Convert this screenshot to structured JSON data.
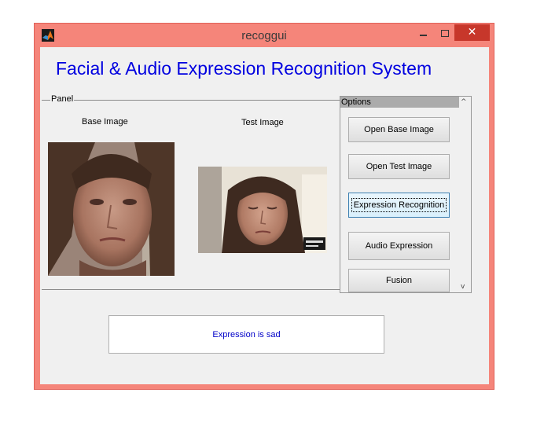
{
  "window": {
    "title": "recoggui",
    "close_glyph": "✕"
  },
  "app": {
    "title": "Facial & Audio Expression Recognition System"
  },
  "panel": {
    "label": "Panel",
    "base_image_caption": "Base Image",
    "test_image_caption": "Test Image"
  },
  "options": {
    "label": "Options",
    "buttons": [
      "Open Base Image",
      "Open Test Image",
      "Expression Recognition",
      "Audio Expression",
      "Fusion"
    ],
    "focused_button": "Expression Recognition"
  },
  "result": {
    "text": "Expression is sad"
  },
  "colors": {
    "title_blue": "#0000e0",
    "result_blue": "#0000c8",
    "window_border": "#f5857a",
    "close_red": "#c7372b"
  },
  "icons": [
    "matlab-icon",
    "minimize-icon",
    "maximize-icon",
    "close-icon",
    "scroll-up-icon",
    "scroll-down-icon"
  ]
}
